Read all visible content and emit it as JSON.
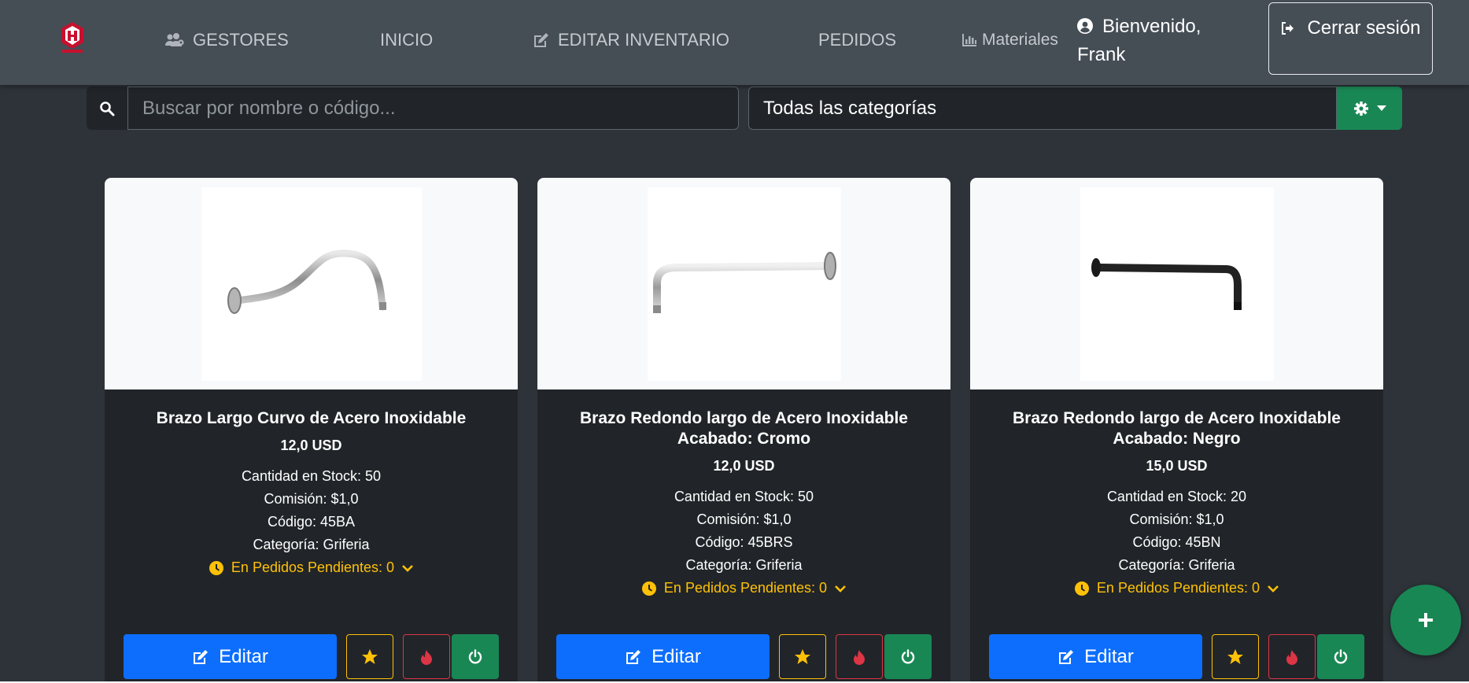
{
  "nav": {
    "links": [
      {
        "label": "GESTORES",
        "icon": "users-gear-icon"
      },
      {
        "label": "INICIO"
      },
      {
        "label": "EDITAR INVENTARIO",
        "icon": "edit-icon"
      },
      {
        "label": "PEDIDOS"
      },
      {
        "label": "Materiales",
        "icon": "chart-icon"
      }
    ],
    "welcome": "Bienvenido, Frank",
    "logout_label": "Cerrar sesión"
  },
  "search": {
    "placeholder": "Buscar por nombre o código...",
    "value": ""
  },
  "category_filter": {
    "selected": "Todas las categorías"
  },
  "colors": {
    "primary": "#0d6efd",
    "success": "#198754",
    "warning": "#ffc107",
    "danger": "#dc3545",
    "card_bg": "#212529",
    "navbar_bg": "#454d55"
  },
  "products": [
    {
      "title": "Brazo Largo Curvo de Acero Inoxidable",
      "price": "12,0 USD",
      "stock": "Cantidad en Stock: 50",
      "commission": "Comisión: $1,0",
      "code": "Código: 45BA",
      "category": "Categoría: Griferia",
      "pending": "En Pedidos Pendientes: 0",
      "finish": "chrome"
    },
    {
      "title": "Brazo Redondo largo de Acero Inoxidable Acabado: Cromo",
      "price": "12,0 USD",
      "stock": "Cantidad en Stock: 50",
      "commission": "Comisión: $1,0",
      "code": "Código: 45BRS",
      "category": "Categoría: Griferia",
      "pending": "En Pedidos Pendientes: 0",
      "finish": "chrome"
    },
    {
      "title": "Brazo Redondo largo de Acero Inoxidable Acabado: Negro",
      "price": "15,0 USD",
      "stock": "Cantidad en Stock: 20",
      "commission": "Comisión: $1,0",
      "code": "Código: 45BN",
      "category": "Categoría: Griferia",
      "pending": "En Pedidos Pendientes: 0",
      "finish": "black"
    }
  ],
  "card_actions": {
    "edit_label": "Editar"
  }
}
